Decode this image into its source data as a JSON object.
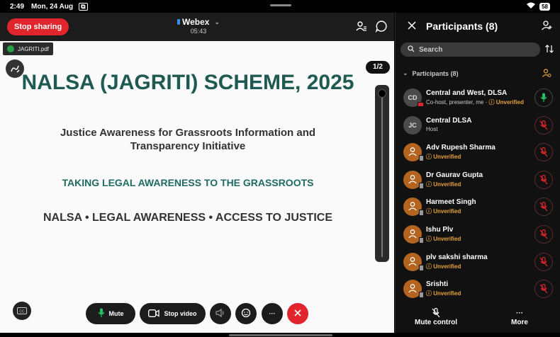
{
  "status_bar": {
    "time": "2:49",
    "date": "Mon, 24 Aug",
    "battery": "58"
  },
  "meeting": {
    "stop_sharing_label": "Stop sharing",
    "app_name": "Webex",
    "elapsed": "05:43",
    "file_name": "JAGRITI.pdf",
    "page_indicator": "1/2"
  },
  "slide": {
    "title": "NALSA (JAGRITI) SCHEME, 2025",
    "subtitle": "Justice Awareness for Grassroots Information and Transparency Initiative",
    "tagline": "TAKING LEGAL AWARENESS TO THE GRASSROOTS",
    "footer": "NALSA • LEGAL AWARENESS • ACCESS TO JUSTICE"
  },
  "controls": {
    "mute_label": "Mute",
    "stop_video_label": "Stop video",
    "more_symbol": "···"
  },
  "panel": {
    "title": "Participants (8)",
    "search_placeholder": "Search",
    "section_label": "Participants (8)",
    "participants": [
      {
        "initials": "CD",
        "name": "Central and West, DLSA",
        "role": "Co-host, presenter, me · ",
        "status": "Unverified",
        "verified": true,
        "mic_on": true
      },
      {
        "initials": "JC",
        "name": "Central DLSA",
        "role": "Host",
        "status": "",
        "verified": true,
        "mic_on": false
      },
      {
        "initials": "",
        "name": "Adv Rupesh Sharma",
        "role": "",
        "status": "Unverified",
        "verified": false,
        "mic_on": false
      },
      {
        "initials": "",
        "name": "Dr Gaurav Gupta",
        "role": "",
        "status": "Unverified",
        "verified": false,
        "mic_on": false
      },
      {
        "initials": "",
        "name": "Harmeet Singh",
        "role": "",
        "status": "Unverified",
        "verified": false,
        "mic_on": false
      },
      {
        "initials": "",
        "name": "Ishu Plv",
        "role": "",
        "status": "Unverified",
        "verified": false,
        "mic_on": false
      },
      {
        "initials": "",
        "name": "plv sakshi sharma",
        "role": "",
        "status": "Unverified",
        "verified": false,
        "mic_on": false
      },
      {
        "initials": "",
        "name": "Srishti",
        "role": "",
        "status": "Unverified",
        "verified": false,
        "mic_on": false
      }
    ],
    "mute_control_label": "Mute control",
    "more_label": "More",
    "more_symbol": "···"
  },
  "colors": {
    "stop_red": "#e0252c",
    "slide_teal": "#1f5a52",
    "unverified_orange": "#e8a33d",
    "mic_on_green": "#27c069",
    "mic_off_red": "#e0252c"
  }
}
